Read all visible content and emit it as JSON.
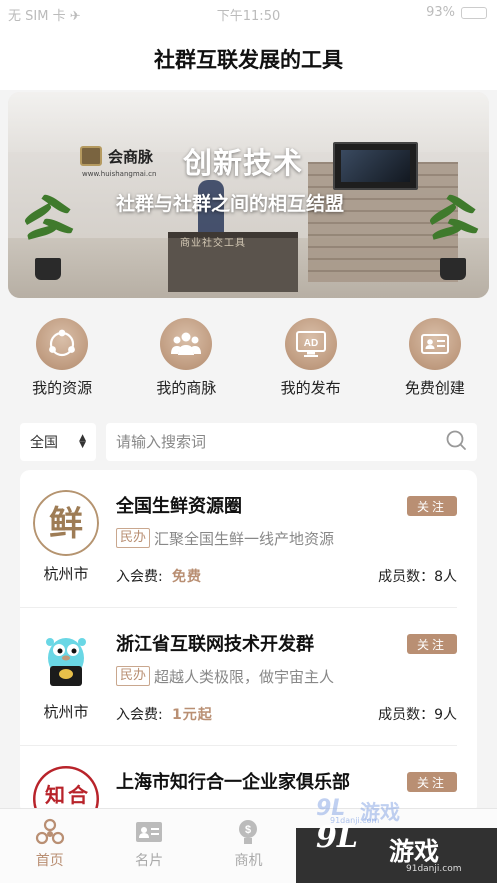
{
  "status_bar": {
    "carrier": "无 SIM 卡 ✈",
    "time": "下午11:50",
    "battery": "93%",
    "battery_level": 0.93
  },
  "header": {
    "title": "社群互联发展的工具"
  },
  "banner": {
    "logo_name": "会商脉",
    "logo_url": "www.huishangmai.cn",
    "headline": "创新技术",
    "subline": "社群与社群之间的相互结盟",
    "desk_text": "商业社交工具"
  },
  "quick_nav": [
    {
      "label": "我的资源",
      "icon": "share-network-icon"
    },
    {
      "label": "我的商脉",
      "icon": "group-people-icon"
    },
    {
      "label": "我的发布",
      "icon": "ad-monitor-icon"
    },
    {
      "label": "免费创建",
      "icon": "id-card-icon"
    }
  ],
  "search": {
    "region": "全国",
    "placeholder": "请输入搜索词"
  },
  "groups": [
    {
      "name": "全国生鲜资源圈",
      "city": "杭州市",
      "tag": "民办",
      "desc": "汇聚全国生鲜一线产地资源",
      "fee_label": "入会费:",
      "fee": "免费",
      "members": "成员数：8人",
      "follow": "关注",
      "avatar": "fresh-logo"
    },
    {
      "name": "浙江省互联网技术开发群",
      "city": "杭州市",
      "tag": "民办",
      "desc": "超越人类极限，做宇宙主人",
      "fee_label": "入会费:",
      "fee": "1元起",
      "members": "成员数：9人",
      "follow": "关注",
      "avatar": "gopher-logo"
    },
    {
      "name": "上海市知行合一企业家俱乐部",
      "city": "",
      "tag": "",
      "desc": "",
      "fee_label": "",
      "fee": "",
      "members": "",
      "follow": "关注",
      "avatar": "zhixing-logo"
    }
  ],
  "tabs": [
    {
      "label": "首页",
      "icon": "home-icon",
      "active": true
    },
    {
      "label": "名片",
      "icon": "card-icon",
      "active": false
    },
    {
      "label": "商机",
      "icon": "money-bulb-icon",
      "active": false
    },
    {
      "label": "",
      "icon": "",
      "active": false
    },
    {
      "label": "",
      "icon": "",
      "active": false
    }
  ],
  "watermark": {
    "brand_num": "9L",
    "brand_text": "游戏",
    "url": "91danji.com"
  },
  "colors": {
    "accent": "#b98f73",
    "battery": "#44c35a"
  }
}
